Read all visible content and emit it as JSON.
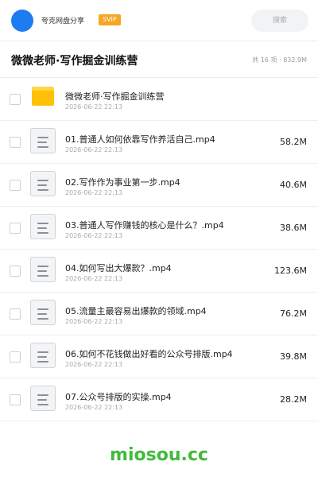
{
  "header": {
    "app_name": "夸克网盘分享",
    "badge": "SVIP",
    "search_placeholder": "搜索"
  },
  "folder": {
    "title": "微微老师·写作掘金训练营",
    "meta": "共 16 项 · 832.9M"
  },
  "items": [
    {
      "type": "folder",
      "name": "微微老师·写作掘金训练营",
      "date": "2026-06-22 22:13",
      "size": ""
    },
    {
      "type": "file",
      "name": "01.普通人如何依靠写作养活自己.mp4",
      "date": "2026-06-22 22:13",
      "size": "58.2M"
    },
    {
      "type": "file",
      "name": "02.写作作为事业第一步.mp4",
      "date": "2026-06-22 22:13",
      "size": "40.6M"
    },
    {
      "type": "file",
      "name": "03.普通人写作赚钱的核心是什么？.mp4",
      "date": "2026-06-22 22:13",
      "size": "38.6M"
    },
    {
      "type": "file",
      "name": "04.如何写出大爆款？.mp4",
      "date": "2026-06-22 22:13",
      "size": "123.6M"
    },
    {
      "type": "file",
      "name": "05.流量主最容易出爆款的领域.mp4",
      "date": "2026-06-22 22:13",
      "size": "76.2M"
    },
    {
      "type": "file",
      "name": "06.如何不花钱做出好看的公众号排版.mp4",
      "date": "2026-06-22 22:13",
      "size": "39.8M"
    },
    {
      "type": "file",
      "name": "07.公众号排版的实操.mp4",
      "date": "2026-06-22 22:13",
      "size": "28.2M"
    }
  ],
  "footer": {
    "watermark": "miosou.cc"
  },
  "colors": {
    "avatar": "#1f7bf2",
    "badge": "#f6a623",
    "folder": "#ffc107",
    "watermark": "#3fbb3a"
  }
}
